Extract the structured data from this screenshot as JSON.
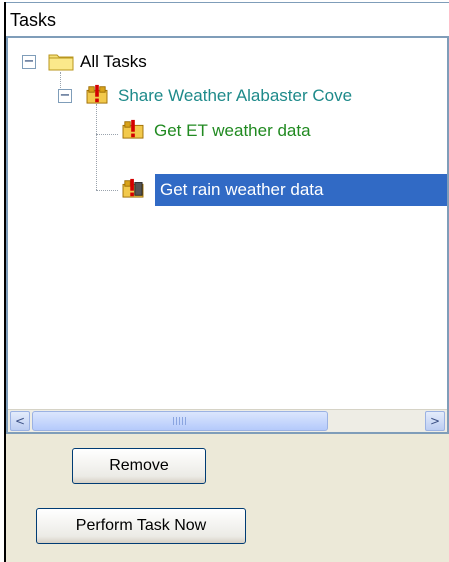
{
  "header": {
    "title": "Tasks"
  },
  "tree": {
    "root": {
      "label": "All Tasks",
      "expander": "−",
      "icon": "folder-icon",
      "color": "#000000"
    },
    "group": {
      "label": "Share Weather Alabaster Cove",
      "expander": "−",
      "icon": "task-group-warning-icon",
      "color": "#1e8a8a"
    },
    "items": [
      {
        "label": "Get ET weather data",
        "icon": "task-warning-icon",
        "color": "#218a21",
        "selected": false
      },
      {
        "label": "Get rain weather data",
        "icon": "task-warning-icon",
        "color": "#ffffff",
        "selected": true
      }
    ]
  },
  "scrollbar": {
    "left_arrow": "<",
    "right_arrow": ">"
  },
  "buttons": {
    "remove": "Remove",
    "perform": "Perform Task Now"
  },
  "colors": {
    "selection": "#316ac5",
    "panel_border": "#7f9db9",
    "background": "#ece9d8"
  }
}
